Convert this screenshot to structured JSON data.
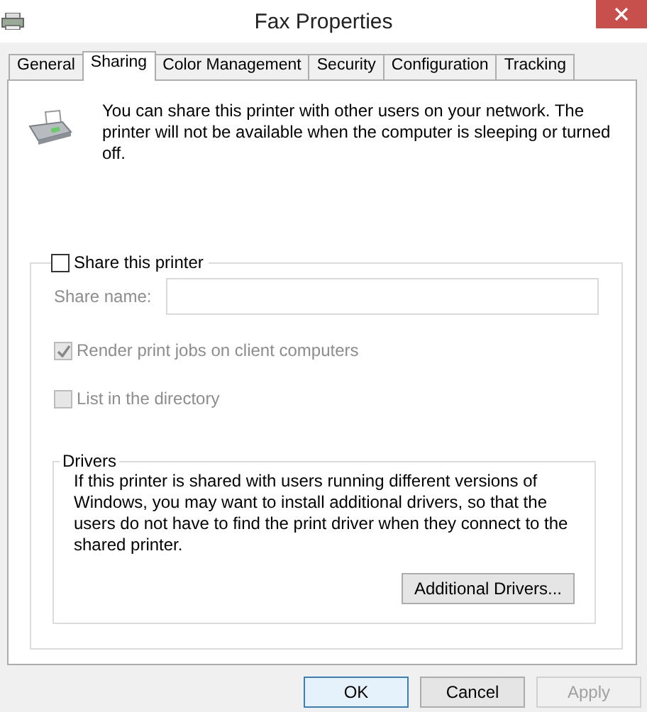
{
  "window": {
    "title": "Fax Properties"
  },
  "tabs": [
    {
      "label": "General",
      "selected": false
    },
    {
      "label": "Sharing",
      "selected": true
    },
    {
      "label": "Color Management",
      "selected": false
    },
    {
      "label": "Security",
      "selected": false
    },
    {
      "label": "Configuration",
      "selected": false
    },
    {
      "label": "Tracking",
      "selected": false
    }
  ],
  "intro": "You can share this printer with other users on your network. The printer will not be available when the computer is sleeping or turned off.",
  "share": {
    "label": "Share this printer",
    "checked": false
  },
  "share_name": {
    "label": "Share name:",
    "disabled": true
  },
  "options": [
    {
      "label": "Render print jobs on client computers",
      "checked": true,
      "disabled": true
    },
    {
      "label": "List in the directory",
      "checked": false,
      "disabled": true
    }
  ],
  "drivers": {
    "title": "Drivers",
    "text": "If this printer is shared with users running different versions of Windows, you may want to install additional drivers, so that the users do not have to find the print driver when they connect to the shared printer.",
    "button": "Additional Drivers..."
  },
  "buttons": [
    {
      "label": "OK",
      "kind": "default",
      "disabled": false
    },
    {
      "label": "Cancel",
      "kind": "normal",
      "disabled": false
    },
    {
      "label": "Apply",
      "kind": "normal",
      "disabled": true
    }
  ]
}
